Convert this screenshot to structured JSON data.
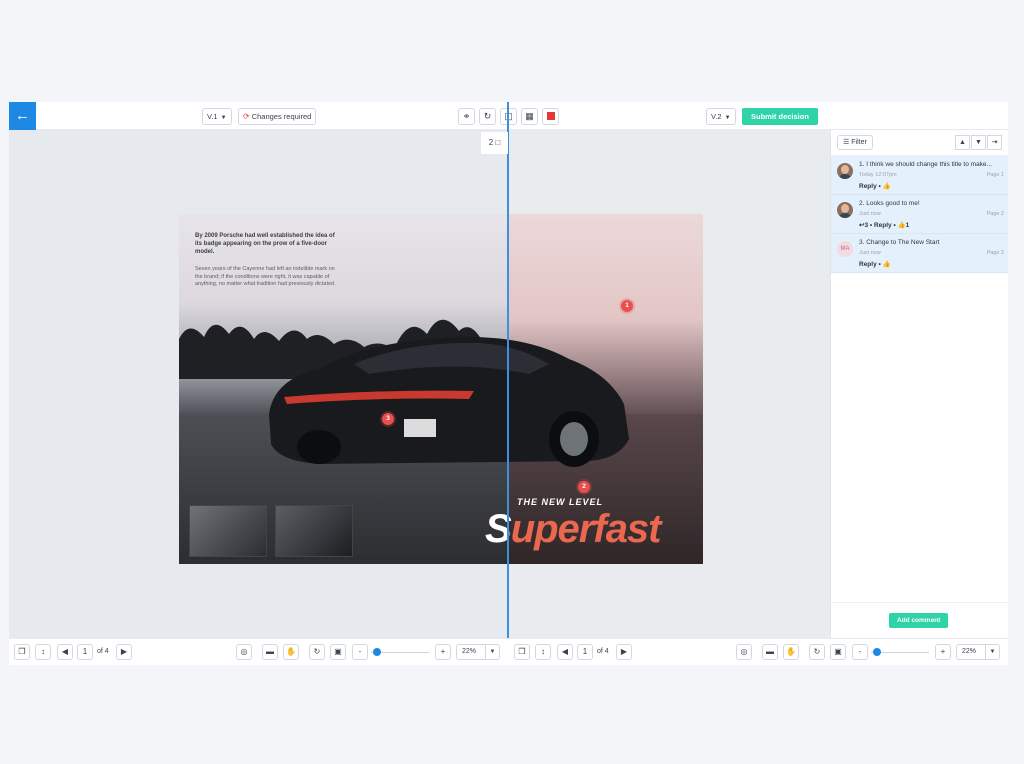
{
  "toolbar": {
    "back_icon": "arrow-left-icon",
    "version_left": "V.1",
    "changes_required": "Changes required",
    "version_right": "V.2",
    "submit_decision": "Submit decision",
    "center_icons": [
      "link-icon",
      "rotate-icon",
      "split-view-icon",
      "diff-icon",
      "color-swatch-icon"
    ],
    "accent_color": "#2ed3a8",
    "brand_color": "#1e88e5"
  },
  "canvas": {
    "comment_count": "2",
    "page": {
      "intro_title": "By 2009 Porsche had well established the idea of its badge appearing on the prow of a five-door model.",
      "intro_body": "Seven years of the Cayenne had left an indelible mark on the brand; if the conditions were right, it was capable of anything, no matter what tradition had previously dictated.",
      "tagline": "THE NEW LEVEL",
      "headline_first": "S",
      "headline_rest": "uperfast"
    },
    "pins": [
      {
        "number": "1"
      },
      {
        "number": "2"
      },
      {
        "number": "3"
      }
    ]
  },
  "comments": {
    "filter_label": "Filter",
    "items": [
      {
        "text": "1. I think we should change this title to make...",
        "time": "Today 12:07pm",
        "page": "Page 1",
        "actions": "Reply • 👍"
      },
      {
        "text": "2. Looks good to me!",
        "time": "Just now",
        "page": "Page 2",
        "actions": "↩3 • Reply • 👍1"
      },
      {
        "text": "3. Change to The New Start",
        "time": "Just now",
        "page": "Page 2",
        "actions": "Reply • 👍",
        "initials": "MA"
      }
    ],
    "add_comment": "Add comment"
  },
  "bottom": {
    "left": {
      "page": "1",
      "of": "of 4",
      "zoom": "22%"
    },
    "right": {
      "page": "1",
      "of": "of 4",
      "zoom": "22%"
    },
    "zoom_minus": "-",
    "zoom_plus": "+"
  }
}
